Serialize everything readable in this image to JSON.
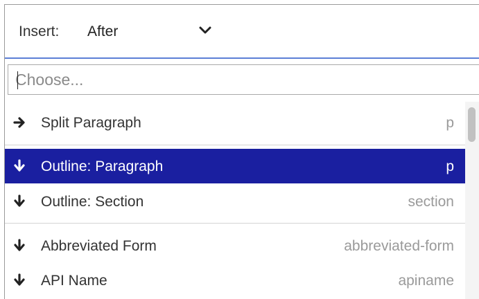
{
  "insert": {
    "label": "Insert:",
    "selected": "After"
  },
  "search": {
    "placeholder": "Choose..."
  },
  "items": [
    {
      "icon": "arrow-right-icon",
      "label": "Split Paragraph",
      "tag": "p"
    },
    {
      "icon": "arrow-down-icon",
      "label": "Outline: Paragraph",
      "tag": "p",
      "selected": true
    },
    {
      "icon": "arrow-down-icon",
      "label": "Outline: Section",
      "tag": "section"
    },
    {
      "icon": "arrow-down-icon",
      "label": "Abbreviated Form",
      "tag": "abbreviated-form"
    },
    {
      "icon": "arrow-down-icon",
      "label": "API Name",
      "tag": "apiname"
    }
  ],
  "colors": {
    "selection": "#1a1fa0",
    "focus_border": "#5b7fd6"
  }
}
